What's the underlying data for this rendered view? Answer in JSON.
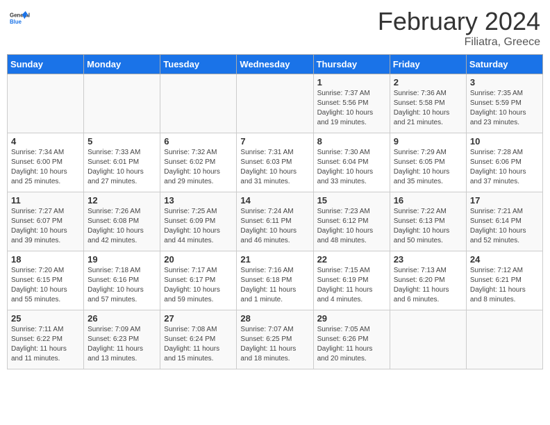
{
  "header": {
    "logo_line1": "General",
    "logo_line2": "Blue",
    "title": "February 2024",
    "subtitle": "Filiatra, Greece"
  },
  "days_of_week": [
    "Sunday",
    "Monday",
    "Tuesday",
    "Wednesday",
    "Thursday",
    "Friday",
    "Saturday"
  ],
  "weeks": [
    [
      {
        "day": "",
        "info": ""
      },
      {
        "day": "",
        "info": ""
      },
      {
        "day": "",
        "info": ""
      },
      {
        "day": "",
        "info": ""
      },
      {
        "day": "1",
        "info": "Sunrise: 7:37 AM\nSunset: 5:56 PM\nDaylight: 10 hours and 19 minutes."
      },
      {
        "day": "2",
        "info": "Sunrise: 7:36 AM\nSunset: 5:58 PM\nDaylight: 10 hours and 21 minutes."
      },
      {
        "day": "3",
        "info": "Sunrise: 7:35 AM\nSunset: 5:59 PM\nDaylight: 10 hours and 23 minutes."
      }
    ],
    [
      {
        "day": "4",
        "info": "Sunrise: 7:34 AM\nSunset: 6:00 PM\nDaylight: 10 hours and 25 minutes."
      },
      {
        "day": "5",
        "info": "Sunrise: 7:33 AM\nSunset: 6:01 PM\nDaylight: 10 hours and 27 minutes."
      },
      {
        "day": "6",
        "info": "Sunrise: 7:32 AM\nSunset: 6:02 PM\nDaylight: 10 hours and 29 minutes."
      },
      {
        "day": "7",
        "info": "Sunrise: 7:31 AM\nSunset: 6:03 PM\nDaylight: 10 hours and 31 minutes."
      },
      {
        "day": "8",
        "info": "Sunrise: 7:30 AM\nSunset: 6:04 PM\nDaylight: 10 hours and 33 minutes."
      },
      {
        "day": "9",
        "info": "Sunrise: 7:29 AM\nSunset: 6:05 PM\nDaylight: 10 hours and 35 minutes."
      },
      {
        "day": "10",
        "info": "Sunrise: 7:28 AM\nSunset: 6:06 PM\nDaylight: 10 hours and 37 minutes."
      }
    ],
    [
      {
        "day": "11",
        "info": "Sunrise: 7:27 AM\nSunset: 6:07 PM\nDaylight: 10 hours and 39 minutes."
      },
      {
        "day": "12",
        "info": "Sunrise: 7:26 AM\nSunset: 6:08 PM\nDaylight: 10 hours and 42 minutes."
      },
      {
        "day": "13",
        "info": "Sunrise: 7:25 AM\nSunset: 6:09 PM\nDaylight: 10 hours and 44 minutes."
      },
      {
        "day": "14",
        "info": "Sunrise: 7:24 AM\nSunset: 6:11 PM\nDaylight: 10 hours and 46 minutes."
      },
      {
        "day": "15",
        "info": "Sunrise: 7:23 AM\nSunset: 6:12 PM\nDaylight: 10 hours and 48 minutes."
      },
      {
        "day": "16",
        "info": "Sunrise: 7:22 AM\nSunset: 6:13 PM\nDaylight: 10 hours and 50 minutes."
      },
      {
        "day": "17",
        "info": "Sunrise: 7:21 AM\nSunset: 6:14 PM\nDaylight: 10 hours and 52 minutes."
      }
    ],
    [
      {
        "day": "18",
        "info": "Sunrise: 7:20 AM\nSunset: 6:15 PM\nDaylight: 10 hours and 55 minutes."
      },
      {
        "day": "19",
        "info": "Sunrise: 7:18 AM\nSunset: 6:16 PM\nDaylight: 10 hours and 57 minutes."
      },
      {
        "day": "20",
        "info": "Sunrise: 7:17 AM\nSunset: 6:17 PM\nDaylight: 10 hours and 59 minutes."
      },
      {
        "day": "21",
        "info": "Sunrise: 7:16 AM\nSunset: 6:18 PM\nDaylight: 11 hours and 1 minute."
      },
      {
        "day": "22",
        "info": "Sunrise: 7:15 AM\nSunset: 6:19 PM\nDaylight: 11 hours and 4 minutes."
      },
      {
        "day": "23",
        "info": "Sunrise: 7:13 AM\nSunset: 6:20 PM\nDaylight: 11 hours and 6 minutes."
      },
      {
        "day": "24",
        "info": "Sunrise: 7:12 AM\nSunset: 6:21 PM\nDaylight: 11 hours and 8 minutes."
      }
    ],
    [
      {
        "day": "25",
        "info": "Sunrise: 7:11 AM\nSunset: 6:22 PM\nDaylight: 11 hours and 11 minutes."
      },
      {
        "day": "26",
        "info": "Sunrise: 7:09 AM\nSunset: 6:23 PM\nDaylight: 11 hours and 13 minutes."
      },
      {
        "day": "27",
        "info": "Sunrise: 7:08 AM\nSunset: 6:24 PM\nDaylight: 11 hours and 15 minutes."
      },
      {
        "day": "28",
        "info": "Sunrise: 7:07 AM\nSunset: 6:25 PM\nDaylight: 11 hours and 18 minutes."
      },
      {
        "day": "29",
        "info": "Sunrise: 7:05 AM\nSunset: 6:26 PM\nDaylight: 11 hours and 20 minutes."
      },
      {
        "day": "",
        "info": ""
      },
      {
        "day": "",
        "info": ""
      }
    ]
  ]
}
